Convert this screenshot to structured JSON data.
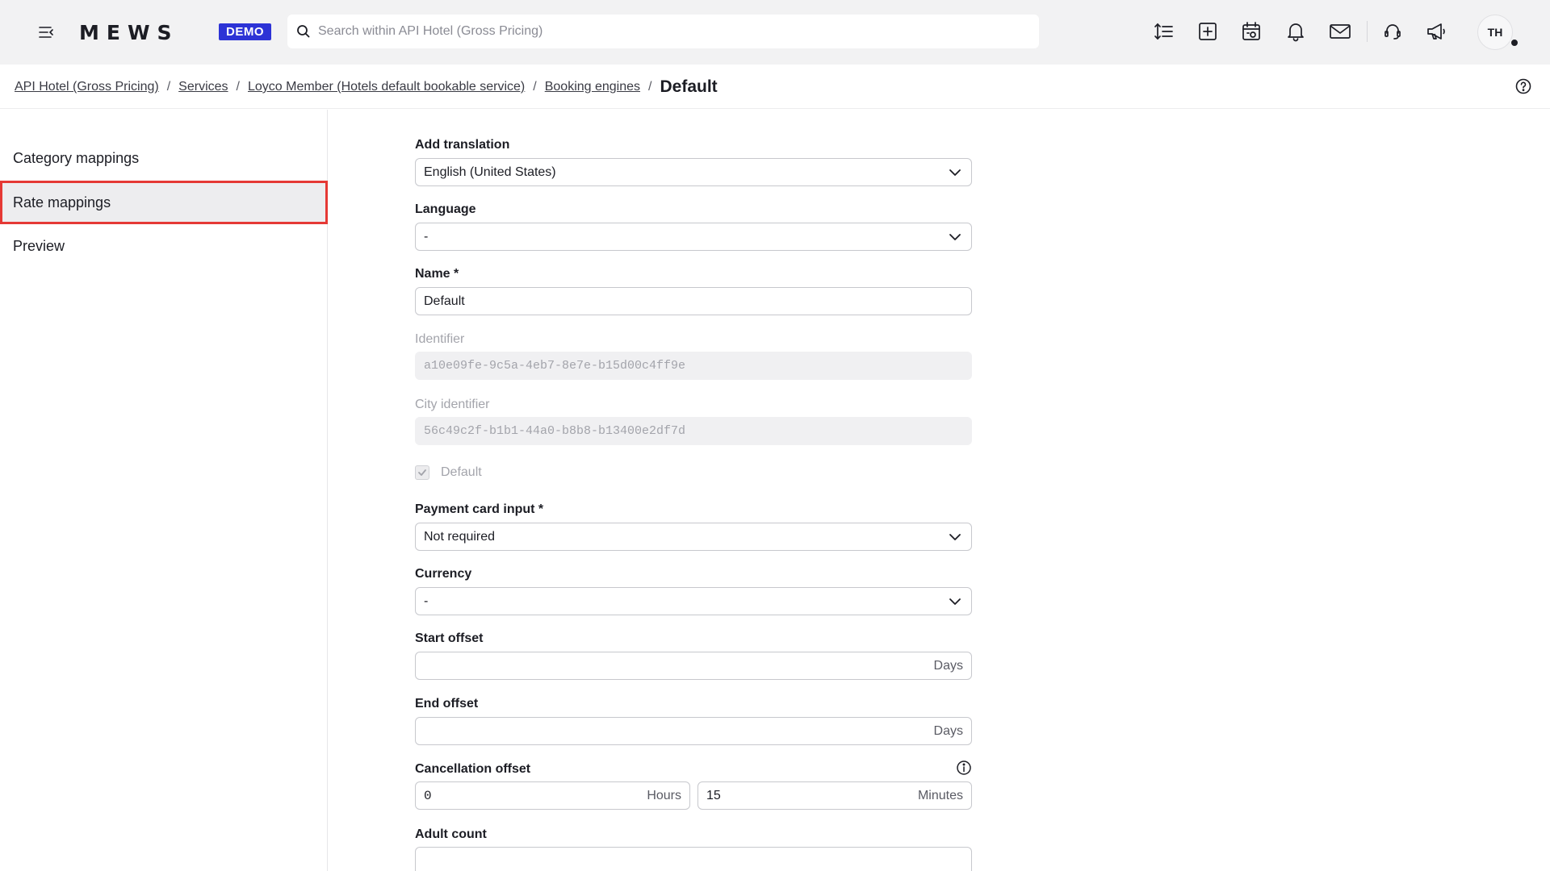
{
  "header": {
    "logo": "MEWS",
    "badge": "DEMO",
    "search_placeholder": "Search within API Hotel (Gross Pricing)",
    "avatar_initials": "TH"
  },
  "breadcrumb": {
    "items": [
      "API Hotel (Gross Pricing)",
      "Services",
      "Loyco Member (Hotels default bookable service)",
      "Booking engines"
    ],
    "current": "Default"
  },
  "sidebar": {
    "items": [
      {
        "label": "Category mappings"
      },
      {
        "label": "Rate mappings"
      },
      {
        "label": "Preview"
      }
    ]
  },
  "form": {
    "add_translation": {
      "label": "Add translation",
      "value": "English (United States)"
    },
    "language": {
      "label": "Language",
      "value": "-"
    },
    "name": {
      "label": "Name *",
      "value": "Default"
    },
    "identifier": {
      "label": "Identifier",
      "value": "a10e09fe-9c5a-4eb7-8e7e-b15d00c4ff9e"
    },
    "city_identifier": {
      "label": "City identifier",
      "value": "56c49c2f-b1b1-44a0-b8b8-b13400e2df7d"
    },
    "default_checkbox": {
      "label": "Default",
      "checked": true
    },
    "payment_card_input": {
      "label": "Payment card input *",
      "value": "Not required"
    },
    "currency": {
      "label": "Currency",
      "value": "-"
    },
    "start_offset": {
      "label": "Start offset",
      "value": "",
      "suffix": "Days"
    },
    "end_offset": {
      "label": "End offset",
      "value": "",
      "suffix": "Days"
    },
    "cancellation_offset": {
      "label": "Cancellation offset",
      "hours": "0",
      "hours_suffix": "Hours",
      "minutes": "15",
      "minutes_suffix": "Minutes"
    },
    "adult_count": {
      "label": "Adult count"
    }
  },
  "colors": {
    "badge": "#2d33d6",
    "highlight": "#e53935",
    "topbar": "#f2f2f3"
  }
}
